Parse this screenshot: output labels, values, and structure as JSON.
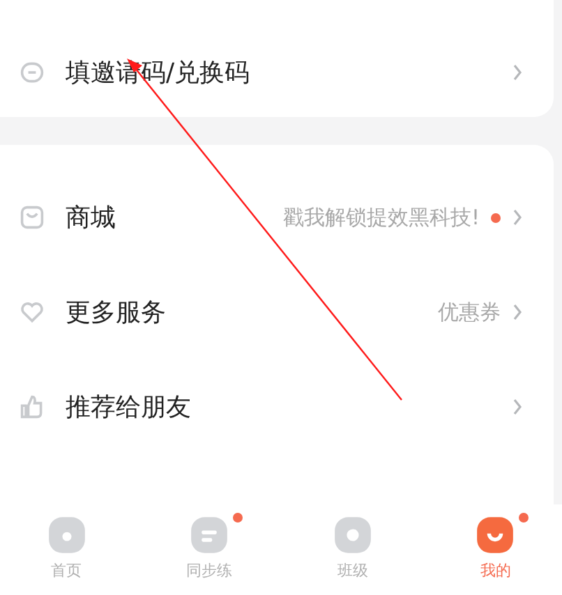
{
  "menu_top": [
    {
      "label": "填邀请码/兑换码"
    }
  ],
  "menu": [
    {
      "label": "商城",
      "note": "戳我解锁提效黑科技!",
      "dot": true
    },
    {
      "label": "更多服务",
      "note": "优惠券",
      "dot": false
    },
    {
      "label": "推荐给朋友",
      "dot": false
    }
  ],
  "tabs": [
    {
      "label": "首页",
      "selected": false,
      "dot": false
    },
    {
      "label": "同步练",
      "selected": false,
      "dot": true
    },
    {
      "label": "班级",
      "selected": false,
      "dot": false
    },
    {
      "label": "我的",
      "selected": true,
      "dot": true
    }
  ]
}
